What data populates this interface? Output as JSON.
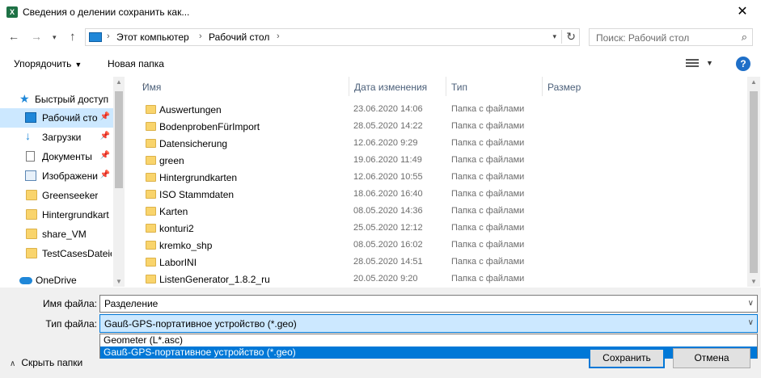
{
  "window": {
    "title": "Сведения о делении сохранить как...",
    "app_icon_letter": "X"
  },
  "address_bar": {
    "crumbs": [
      "Этот компьютер",
      "Рабочий стол"
    ],
    "search_placeholder": "Поиск: Рабочий стол"
  },
  "toolbar": {
    "organize_label": "Упорядочить",
    "new_folder_label": "Новая папка",
    "help_label": "?"
  },
  "nav": {
    "items": [
      {
        "label": "Быстрый доступ",
        "icon": "star-icon",
        "pinned": false
      },
      {
        "label": "Рабочий сто",
        "icon": "desktop-icon",
        "pinned": true,
        "selected": true
      },
      {
        "label": "Загрузки",
        "icon": "download-icon",
        "pinned": true
      },
      {
        "label": "Документы",
        "icon": "document-icon",
        "pinned": true
      },
      {
        "label": "Изображени",
        "icon": "image-icon",
        "pinned": true
      },
      {
        "label": "Greenseeker",
        "icon": "folder-icon"
      },
      {
        "label": "Hintergrundkart",
        "icon": "folder-icon"
      },
      {
        "label": "share_VM",
        "icon": "folder-icon"
      },
      {
        "label": "TestCasesDateien",
        "icon": "folder-icon"
      },
      {
        "label": "OneDrive",
        "icon": "cloud-icon"
      }
    ]
  },
  "columns": {
    "name": "Имя",
    "date": "Дата изменения",
    "type": "Тип",
    "size": "Размер"
  },
  "files": [
    {
      "name": "Auswertungen",
      "date": "23.06.2020 14:06",
      "type": "Папка с файлами"
    },
    {
      "name": "BodenprobenFürImport",
      "date": "28.05.2020 14:22",
      "type": "Папка с файлами"
    },
    {
      "name": "Datensicherung",
      "date": "12.06.2020 9:29",
      "type": "Папка с файлами"
    },
    {
      "name": "green",
      "date": "19.06.2020 11:49",
      "type": "Папка с файлами"
    },
    {
      "name": "Hintergrundkarten",
      "date": "12.06.2020 10:55",
      "type": "Папка с файлами"
    },
    {
      "name": "ISO Stammdaten",
      "date": "18.06.2020 16:40",
      "type": "Папка с файлами"
    },
    {
      "name": "Karten",
      "date": "08.05.2020 14:36",
      "type": "Папка с файлами"
    },
    {
      "name": "konturi2",
      "date": "25.05.2020 12:12",
      "type": "Папка с файлами"
    },
    {
      "name": "kremko_shp",
      "date": "08.05.2020 16:02",
      "type": "Папка с файлами"
    },
    {
      "name": "LaborINI",
      "date": "28.05.2020 14:51",
      "type": "Папка с файлами"
    },
    {
      "name": "ListenGenerator_1.8.2_ru",
      "date": "20.05.2020 9:20",
      "type": "Папка с файлами"
    }
  ],
  "form": {
    "filename_label": "Имя файла:",
    "filename_value": "Разделение",
    "filetype_label": "Тип файла:",
    "filetype_value": "Gauß-GPS-портативное устройство (*.geo)",
    "filetype_options": [
      "Geometer (L*.asc)",
      "Gauß-GPS-портативное устройство (*.geo)"
    ],
    "filetype_selected_index": 1
  },
  "footer": {
    "hide_folders_label": "Скрыть папки",
    "save_label": "Сохранить",
    "cancel_label": "Отмена"
  },
  "colors": {
    "accent": "#0078d7",
    "selection": "#cce8ff",
    "folder": "#f9d46c"
  }
}
